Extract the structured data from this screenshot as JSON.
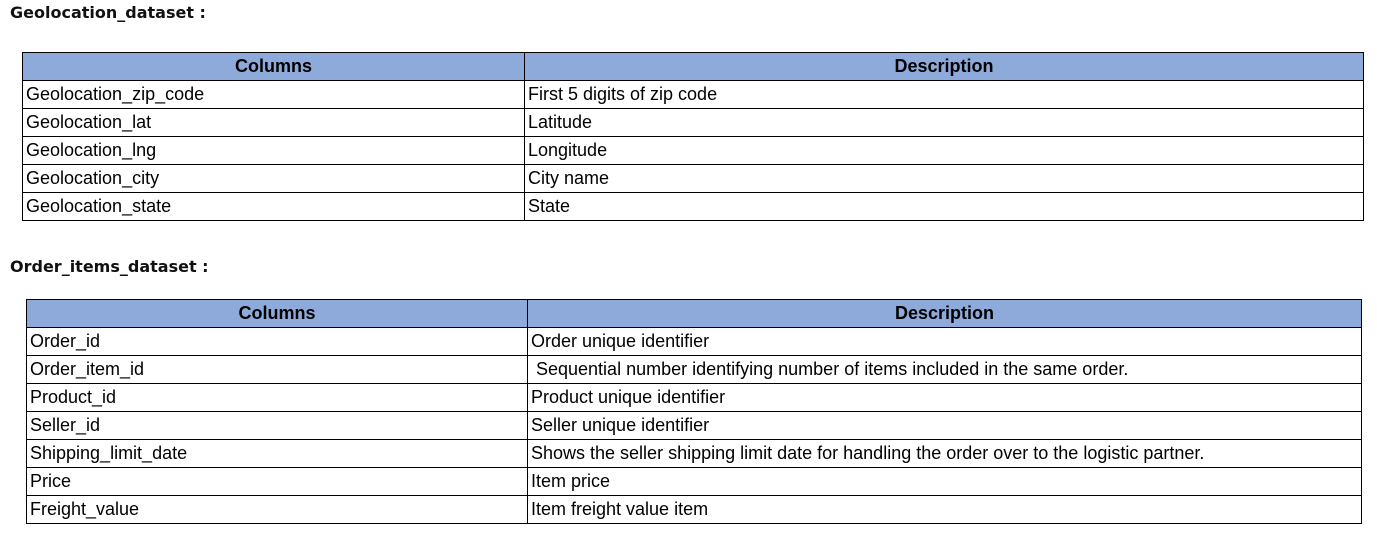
{
  "geolocation": {
    "title": "Geolocation_dataset :",
    "headers": [
      "Columns",
      "Description"
    ],
    "rows": [
      [
        "Geolocation_zip_code",
        "First 5 digits of zip code"
      ],
      [
        "Geolocation_lat",
        "Latitude"
      ],
      [
        "Geolocation_lng",
        "Longitude"
      ],
      [
        "Geolocation_city",
        "City name"
      ],
      [
        "Geolocation_state",
        "State"
      ]
    ]
  },
  "order_items": {
    "title": "Order_items_dataset :",
    "headers": [
      "Columns",
      "Description"
    ],
    "rows": [
      [
        "Order_id",
        "Order unique identifier"
      ],
      [
        "Order_item_id",
        " Sequential number identifying number of items included in the same order."
      ],
      [
        "Product_id",
        "Product unique identifier"
      ],
      [
        "Seller_id",
        "Seller unique identifier"
      ],
      [
        "Shipping_limit_date",
        "Shows the seller shipping limit date for handling the order over to the logistic partner."
      ],
      [
        "Price",
        "Item price"
      ],
      [
        "Freight_value",
        "Item freight value item"
      ]
    ]
  },
  "colors": {
    "header_fill": "#8eaadb",
    "border": "#000000"
  }
}
